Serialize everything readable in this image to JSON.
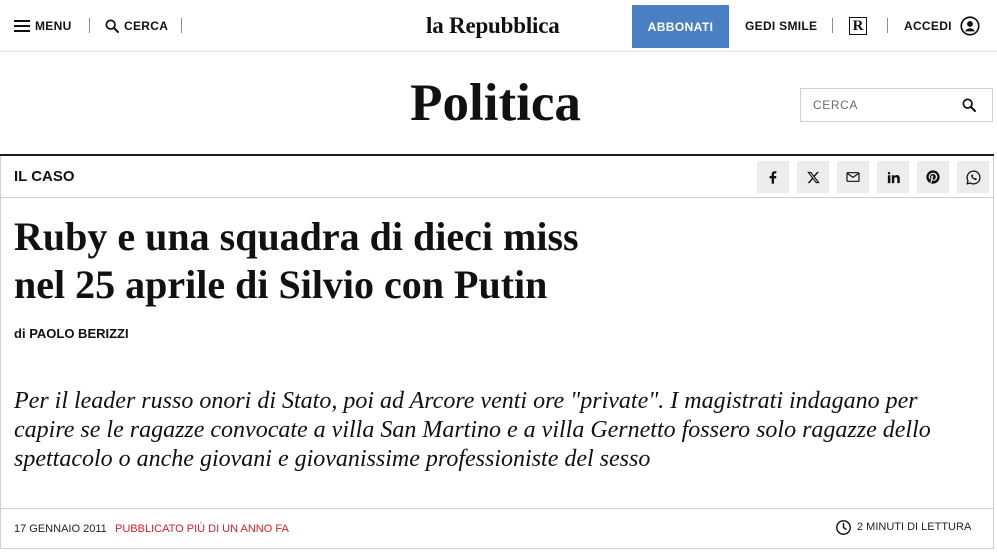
{
  "header": {
    "menu_label": "MENU",
    "menu_icon": "hamburger-icon",
    "search_label": "CERCA",
    "search_icon": "search-icon",
    "logo": "la Repubblica",
    "subscribe_label": "ABBONATI",
    "gedi_label": "GEDI SMILE",
    "r_badge": "R",
    "login_label": "ACCEDI",
    "login_icon": "user-icon"
  },
  "section": {
    "title": "Politica",
    "search_placeholder": "CERCA",
    "search_icon": "search-icon"
  },
  "article": {
    "kicker": "IL CASO",
    "share_icons": [
      "facebook-icon",
      "x-icon",
      "mail-icon",
      "linkedin-icon",
      "pinterest-icon",
      "whatsapp-icon"
    ],
    "headline": "Ruby e una squadra di dieci miss nel 25 aprile di Silvio con Putin",
    "byline_prefix": "di",
    "author": "PAOLO BERIZZI",
    "summary": "Per il leader russo onori di Stato, poi ad Arcore venti ore \"private\". I magistrati indagano per capire se le ragazze convocate a villa San Martino e a villa Gernetto fossero solo ragazze dello spettacolo o anche giovani e giovanissime professioniste del sesso",
    "date": "17 GENNAIO 2011",
    "published_note": "PUBBLICATO PIÙ DI UN ANNO FA",
    "reading_time": "2 MINUTI DI LETTURA",
    "reading_icon": "clock-icon"
  },
  "colors": {
    "accent": "#4b7fc4",
    "published_note": "#d61f26",
    "text": "#111111",
    "rule": "#1b1b1b",
    "share_bg": "#ececec"
  }
}
